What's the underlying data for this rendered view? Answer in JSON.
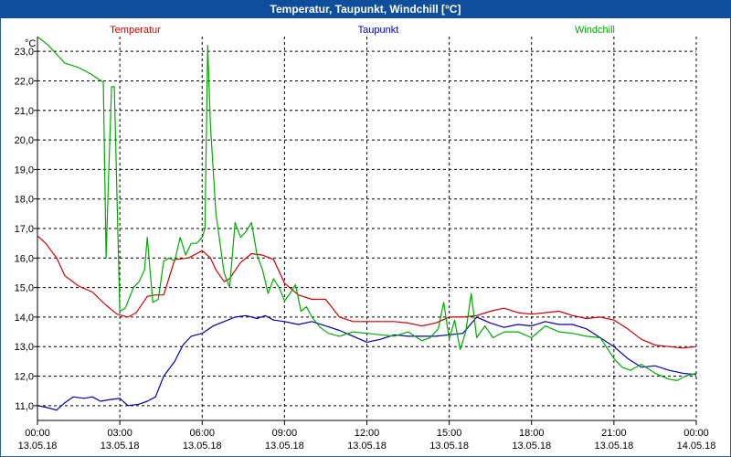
{
  "window": {
    "title": "Temperatur, Taupunkt, Windchill [°C]"
  },
  "colors": {
    "title_bg": "#0e4e9a",
    "temperatur": "#cc0000",
    "taupunkt": "#0000aa",
    "windchill": "#00aa00",
    "grid": "#000000"
  },
  "chart_data": {
    "type": "line",
    "title": "Temperatur, Taupunkt, Windchill [°C]",
    "ylabel": "°C",
    "ylim": [
      10.5,
      23.5
    ],
    "yticks": [
      "11,0",
      "12,0",
      "13,0",
      "14,0",
      "15,0",
      "16,0",
      "17,0",
      "18,0",
      "19,0",
      "20,0",
      "21,0",
      "22,0",
      "23,0"
    ],
    "xlim": [
      0,
      24
    ],
    "xticks": [
      {
        "time": "00:00",
        "date": "13.05.18",
        "h": 0
      },
      {
        "time": "03:00",
        "date": "13.05.18",
        "h": 3
      },
      {
        "time": "06:00",
        "date": "13.05.18",
        "h": 6
      },
      {
        "time": "09:00",
        "date": "13.05.18",
        "h": 9
      },
      {
        "time": "12:00",
        "date": "13.05.18",
        "h": 12
      },
      {
        "time": "15:00",
        "date": "13.05.18",
        "h": 15
      },
      {
        "time": "18:00",
        "date": "13.05.18",
        "h": 18
      },
      {
        "time": "21:00",
        "date": "13.05.18",
        "h": 21
      },
      {
        "time": "00:00",
        "date": "14.05.18",
        "h": 24
      }
    ],
    "grid": true,
    "legend_placement": "top",
    "series": [
      {
        "name": "Temperatur",
        "color_key": "temperatur",
        "x": [
          0,
          0.3,
          0.7,
          1.0,
          1.5,
          2.0,
          2.5,
          2.9,
          3.3,
          3.6,
          4.0,
          4.3,
          4.6,
          5.0,
          5.5,
          6.0,
          6.3,
          6.5,
          6.8,
          7.0,
          7.4,
          7.8,
          8.2,
          8.6,
          9.0,
          9.5,
          10.0,
          10.5,
          11.0,
          11.5,
          12.0,
          12.5,
          13.0,
          13.5,
          14.0,
          14.5,
          15.0,
          15.5,
          16.0,
          16.5,
          17.0,
          17.5,
          18.0,
          18.5,
          19.0,
          19.5,
          20.0,
          20.5,
          21.0,
          21.5,
          22.0,
          22.5,
          23.0,
          23.5,
          24.0
        ],
        "y": [
          16.75,
          16.5,
          16.0,
          15.4,
          15.05,
          14.85,
          14.4,
          14.1,
          14.0,
          14.15,
          14.7,
          14.75,
          14.75,
          15.95,
          16.0,
          16.25,
          16.0,
          15.6,
          15.2,
          15.3,
          15.85,
          16.15,
          16.1,
          15.95,
          15.15,
          14.75,
          14.6,
          14.6,
          14.0,
          13.85,
          13.85,
          13.85,
          13.85,
          13.8,
          13.7,
          13.8,
          14.0,
          14.0,
          14.05,
          14.2,
          14.3,
          14.15,
          14.1,
          14.15,
          14.2,
          14.05,
          13.95,
          14.0,
          13.9,
          13.6,
          13.25,
          13.05,
          13.0,
          12.95,
          13.0
        ]
      },
      {
        "name": "Taupunkt",
        "color_key": "taupunkt",
        "x": [
          0,
          0.3,
          0.7,
          1.0,
          1.3,
          1.7,
          2.0,
          2.3,
          2.6,
          3.0,
          3.3,
          3.7,
          4.0,
          4.3,
          4.6,
          5.0,
          5.3,
          5.6,
          6.0,
          6.4,
          6.8,
          7.2,
          7.6,
          8.0,
          8.3,
          8.6,
          9.0,
          9.5,
          10.0,
          10.5,
          11.0,
          11.5,
          12.0,
          12.5,
          13.0,
          13.5,
          14.0,
          14.5,
          15.0,
          15.5,
          16.0,
          16.5,
          17.0,
          17.5,
          18.0,
          18.5,
          19.0,
          19.5,
          20.0,
          20.5,
          21.0,
          21.5,
          22.0,
          22.5,
          23.0,
          23.5,
          24.0
        ],
        "y": [
          11.0,
          10.95,
          10.85,
          11.1,
          11.3,
          11.25,
          11.3,
          11.15,
          11.2,
          11.25,
          11.0,
          11.05,
          11.15,
          11.3,
          12.0,
          12.5,
          13.05,
          13.35,
          13.45,
          13.7,
          13.85,
          14.0,
          14.05,
          13.95,
          14.05,
          13.9,
          13.85,
          13.75,
          13.85,
          13.7,
          13.55,
          13.35,
          13.15,
          13.25,
          13.4,
          13.35,
          13.35,
          13.35,
          13.4,
          13.45,
          14.0,
          13.8,
          13.65,
          13.75,
          13.7,
          13.85,
          13.75,
          13.75,
          13.6,
          13.3,
          13.0,
          12.6,
          12.3,
          12.35,
          12.2,
          12.1,
          12.05
        ]
      },
      {
        "name": "Windchill",
        "color_key": "windchill",
        "x": [
          0,
          0.4,
          0.8,
          1.0,
          1.5,
          2.0,
          2.4,
          2.5,
          2.6,
          2.7,
          2.8,
          2.9,
          3.0,
          3.2,
          3.5,
          3.7,
          3.9,
          4.0,
          4.2,
          4.4,
          4.6,
          4.8,
          5.0,
          5.2,
          5.4,
          5.6,
          5.8,
          6.0,
          6.1,
          6.2,
          6.3,
          6.5,
          6.8,
          7.0,
          7.2,
          7.4,
          7.6,
          7.8,
          8.0,
          8.2,
          8.4,
          8.6,
          8.8,
          9.0,
          9.2,
          9.4,
          9.6,
          9.8,
          10.0,
          10.3,
          10.6,
          11.0,
          11.5,
          12.0,
          12.5,
          13.0,
          13.5,
          14.0,
          14.3,
          14.6,
          14.8,
          15.0,
          15.2,
          15.4,
          15.6,
          15.8,
          16.0,
          16.3,
          16.6,
          17.0,
          17.5,
          18.0,
          18.5,
          19.0,
          19.5,
          20.0,
          20.5,
          21.0,
          21.3,
          21.6,
          22.0,
          22.5,
          23.0,
          23.3,
          23.6,
          24.0
        ],
        "y": [
          23.5,
          23.2,
          22.8,
          22.6,
          22.45,
          22.2,
          21.95,
          16.0,
          19.0,
          21.8,
          21.8,
          18.0,
          14.2,
          14.3,
          15.0,
          15.2,
          15.6,
          16.7,
          14.5,
          14.6,
          15.9,
          16.0,
          15.9,
          16.7,
          16.1,
          16.5,
          16.5,
          16.7,
          17.0,
          23.2,
          20.5,
          17.5,
          15.5,
          15.0,
          17.2,
          16.7,
          16.9,
          17.2,
          16.1,
          15.6,
          14.8,
          15.3,
          15.0,
          14.55,
          14.8,
          15.1,
          14.2,
          14.35,
          14.0,
          13.65,
          13.45,
          13.35,
          13.5,
          13.45,
          13.4,
          13.35,
          13.5,
          13.2,
          13.3,
          13.6,
          14.5,
          13.25,
          13.9,
          12.9,
          13.5,
          14.8,
          13.3,
          13.7,
          13.3,
          13.5,
          13.5,
          13.3,
          13.7,
          13.5,
          13.45,
          13.35,
          13.3,
          12.6,
          12.3,
          12.2,
          12.4,
          12.1,
          11.9,
          11.85,
          12.0,
          12.1
        ]
      }
    ]
  }
}
